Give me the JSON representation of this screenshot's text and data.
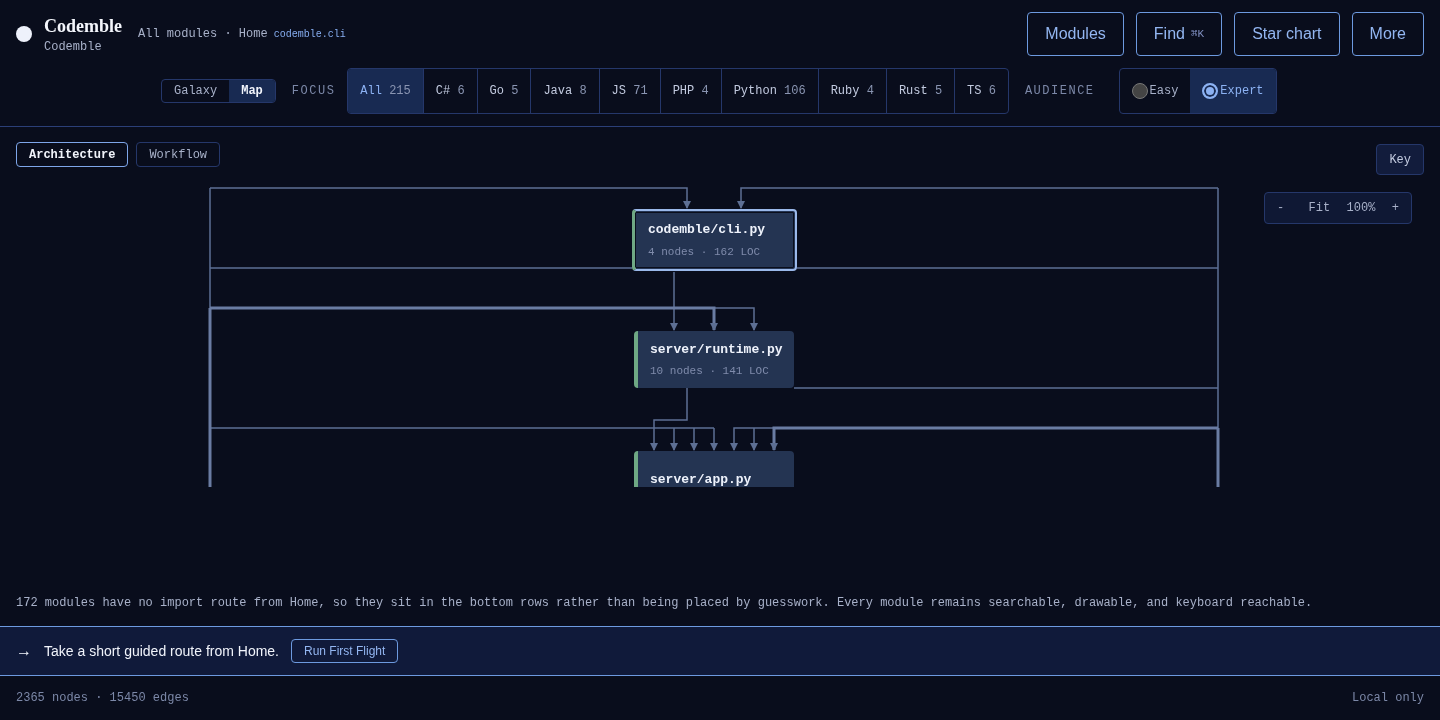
{
  "brand": {
    "name": "Codemble",
    "subtitle": "Codemble"
  },
  "breadcrumb": {
    "label": "All modules · Home",
    "module": "codemble.cli"
  },
  "actions": [
    {
      "label": "Modules"
    },
    {
      "label": "Find",
      "shortcut": "⌘K"
    },
    {
      "label": "Star chart"
    },
    {
      "label": "More"
    }
  ],
  "view_toggle": [
    {
      "label": "Galaxy",
      "selected": false
    },
    {
      "label": "Map",
      "selected": true
    }
  ],
  "focus": {
    "label": "FOCUS",
    "filters": [
      {
        "label": "All",
        "count": "215",
        "selected": true
      },
      {
        "label": "C#",
        "count": "6",
        "selected": false
      },
      {
        "label": "Go",
        "count": "5",
        "selected": false
      },
      {
        "label": "Java",
        "count": "8",
        "selected": false
      },
      {
        "label": "JS",
        "count": "71",
        "selected": false
      },
      {
        "label": "PHP",
        "count": "4",
        "selected": false
      },
      {
        "label": "Python",
        "count": "106",
        "selected": false
      },
      {
        "label": "Ruby",
        "count": "4",
        "selected": false
      },
      {
        "label": "Rust",
        "count": "5",
        "selected": false
      },
      {
        "label": "TS",
        "count": "6",
        "selected": false
      }
    ]
  },
  "audience": {
    "label": "AUDIENCE",
    "options": [
      {
        "label": "Easy",
        "selected": false
      },
      {
        "label": "Expert",
        "selected": true
      }
    ]
  },
  "map_tabs": [
    {
      "label": "Architecture",
      "selected": true
    },
    {
      "label": "Workflow",
      "selected": false
    }
  ],
  "key_button": "Key",
  "zoom": {
    "minus": "-",
    "fit": "Fit",
    "percent": "100%",
    "plus": "+"
  },
  "graph": {
    "nodes": [
      {
        "name": "codemble/cli.py",
        "meta": "4 nodes · 162 LOC",
        "selected": true
      },
      {
        "name": "server/runtime.py",
        "meta": "10 nodes · 141 LOC",
        "selected": false
      },
      {
        "name": "server/app.py",
        "selected": false
      }
    ]
  },
  "note": "172 modules have no import route from Home, so they sit in the bottom rows rather than being placed by guesswork. Every module remains searchable, drawable, and keyboard reachable.",
  "banner": {
    "arrow": "→",
    "text": "Take a short guided route from Home.",
    "button": "Run First Flight"
  },
  "status_bar": {
    "counts": "2365 nodes · 15450 edges",
    "mode": "Local only"
  }
}
